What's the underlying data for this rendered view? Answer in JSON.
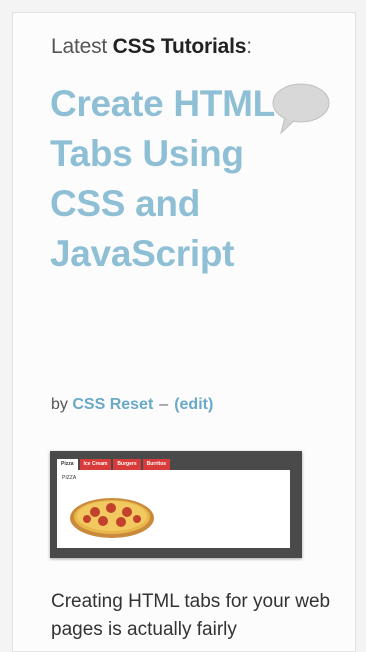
{
  "heading": {
    "prefix": "Latest",
    "bold": "CSS Tutorials",
    "suffix": ":"
  },
  "post": {
    "title": "Create HTML Tabs Using CSS and JavaScript",
    "byline_prefix": "by",
    "author": "CSS Reset",
    "separator": "–",
    "edit_link": "(edit)",
    "comment_icon": "speech-bubble-icon",
    "thumbnail": {
      "tabs": [
        "Pizza",
        "Ice Cream",
        "Burgers",
        "Burritos"
      ],
      "active_tab": "Pizza",
      "panel_label": "PIZZA",
      "image": "pizza"
    },
    "excerpt": "Creating HTML tabs for your web pages is actually fairly"
  },
  "colors": {
    "title": "#8ebfd5",
    "link": "#6aa9c7",
    "tab_inactive": "#d93a3a"
  }
}
